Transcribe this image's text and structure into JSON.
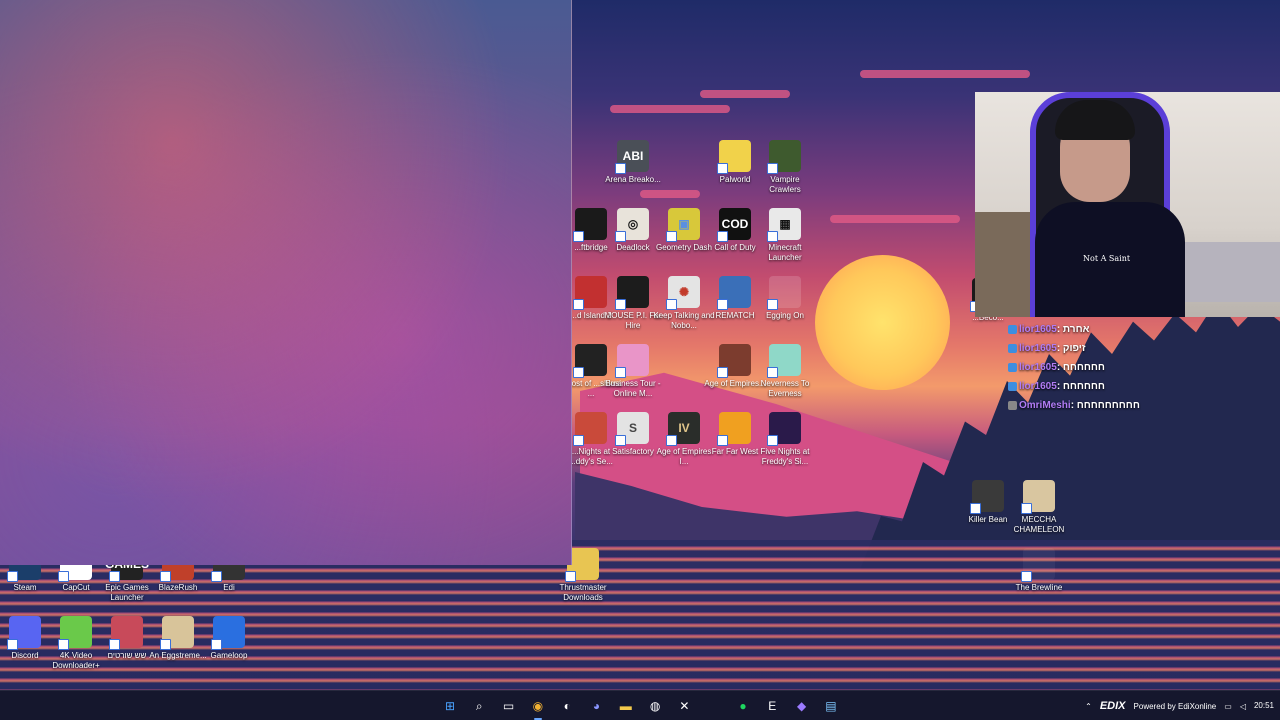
{
  "desktop": {
    "icons": [
      {
        "label": "Arena Breako...",
        "glyph": "ABI",
        "bg": "#4a4f57",
        "fg": "#ffffff"
      },
      {
        "label": "Palworld",
        "glyph": "",
        "bg": "#f1d24a",
        "fg": "#2b6bb5"
      },
      {
        "label": "Vampire Crawlers",
        "glyph": "",
        "bg": "#3e5a2e",
        "fg": "#ffffff"
      },
      {
        "label": "Deadlock",
        "glyph": "◎",
        "bg": "#e8e3da",
        "fg": "#1a1a1a"
      },
      {
        "label": "Geometry Dash",
        "glyph": "▣",
        "bg": "#d8c83a",
        "fg": "#5a8fe0"
      },
      {
        "label": "Call of Duty",
        "glyph": "COD",
        "bg": "#111111",
        "fg": "#ffffff"
      },
      {
        "label": "Minecraft Launcher",
        "glyph": "▦",
        "bg": "#e9e9e9",
        "fg": "#111111"
      },
      {
        "label": "MOUSE P.I. For Hire",
        "glyph": "",
        "bg": "#1c1c1c",
        "fg": "#ffffff"
      },
      {
        "label": "Keep Talking and Nobo...",
        "glyph": "✺",
        "bg": "#e4e4e4",
        "fg": "#c23a2a"
      },
      {
        "label": "REMATCH",
        "glyph": "",
        "bg": "#3a6fb8",
        "fg": "#ffffff"
      },
      {
        "label": "Egging On",
        "glyph": "",
        "bg": "rgba(255,255,255,0.15)",
        "fg": "#ffffff"
      },
      {
        "label": "Business Tour - Online M...",
        "glyph": "",
        "bg": "#e995c8",
        "fg": "#ffffff"
      },
      {
        "label": "Age of Empires...",
        "glyph": "",
        "bg": "#7c3c2e",
        "fg": "#ffffff"
      },
      {
        "label": "Neverness To Everness",
        "glyph": "",
        "bg": "#8fd8c8",
        "fg": "#ffffff"
      },
      {
        "label": "Satisfactory",
        "glyph": "S",
        "bg": "#e3e3e3",
        "fg": "#444444"
      },
      {
        "label": "Age of Empires I...",
        "glyph": "IV",
        "bg": "#2a2d2a",
        "fg": "#e0c58a"
      },
      {
        "label": "Far Far West",
        "glyph": "",
        "bg": "#f0a020",
        "fg": "#1a1a1a"
      },
      {
        "label": "Five Nights at Freddy's Si...",
        "glyph": "",
        "bg": "#2a1a4a",
        "fg": "#ffffff"
      },
      {
        "label": "Killer Bean",
        "glyph": "",
        "bg": "#3a3a3a",
        "fg": "#ffffff"
      },
      {
        "label": "MECCHA CHAMELEON",
        "glyph": "",
        "bg": "#d9c6a0",
        "fg": "#ffffff"
      },
      {
        "label": "The Brewline",
        "glyph": "",
        "bg": "rgba(255,255,255,0.05)",
        "fg": "#ffffff"
      },
      {
        "label": "Thrustmaster Downloads",
        "glyph": "",
        "bg": "#e8c552",
        "fg": "#ffffff"
      },
      {
        "label": "Steam",
        "glyph": "",
        "bg": "#1b3e6a",
        "fg": "#ffffff"
      },
      {
        "label": "CapCut",
        "glyph": "",
        "bg": "#ffffff",
        "fg": "#111111"
      },
      {
        "label": "Epic Games Launcher",
        "glyph": "GAMES",
        "bg": "#222222",
        "fg": "#ffffff"
      },
      {
        "label": "BlazeRush",
        "glyph": "",
        "bg": "#c0402a",
        "fg": "#ffffff"
      },
      {
        "label": "Edi",
        "glyph": "",
        "bg": "#333333",
        "fg": "#ffffff"
      },
      {
        "label": "Discord",
        "glyph": "",
        "bg": "#5865f2",
        "fg": "#ffffff"
      },
      {
        "label": "4K Video Downloader+",
        "glyph": "",
        "bg": "#6ac94a",
        "fg": "#ffffff"
      },
      {
        "label": "שש שורטים",
        "glyph": "",
        "bg": "#c84a5a",
        "fg": "#ffffff"
      },
      {
        "label": "An Eggstreme...",
        "glyph": "",
        "bg": "#d8c49a",
        "fg": "#ffffff"
      },
      {
        "label": "Gameloop",
        "glyph": "",
        "bg": "#2a6fe0",
        "fg": "#ffffff"
      }
    ],
    "partial_labels": [
      {
        "text": "...ftbridge"
      },
      {
        "text": "...d Island 2"
      },
      {
        "text": "...host of ...shima ..."
      },
      {
        "text": "...Nights at ...ddy's Se..."
      },
      {
        "text": "...Beco..."
      }
    ]
  },
  "chat": {
    "lines": [
      {
        "user": "lior1605",
        "msg": ": אחרת"
      },
      {
        "user": "lior1605",
        "msg": ": זיפוק"
      },
      {
        "user": "lior1605",
        "msg": ": חחחחחח"
      },
      {
        "user": "lior1605",
        "msg": ": חחחחחח"
      },
      {
        "user": "OmriMeshi",
        "msg": ": חחחחחחחחח"
      }
    ]
  },
  "webcam": {
    "shirt_text": "Not A Saint"
  },
  "taskbar": {
    "apps": [
      {
        "name": "start",
        "glyph": "⊞",
        "color": "#4aa3ff"
      },
      {
        "name": "search",
        "glyph": "⌕",
        "color": "#ffffff"
      },
      {
        "name": "task-view",
        "glyph": "▭",
        "color": "#ffffff"
      },
      {
        "name": "chrome",
        "glyph": "◉",
        "color": "#f2b233"
      },
      {
        "name": "steam",
        "glyph": "◐",
        "color": "#ffffff"
      },
      {
        "name": "discord",
        "glyph": "◕",
        "color": "#8a96ff"
      },
      {
        "name": "file-explorer",
        "glyph": "▬",
        "color": "#f2c94c"
      },
      {
        "name": "obs",
        "glyph": "◍",
        "color": "#ffffff"
      },
      {
        "name": "capcut",
        "glyph": "✕",
        "color": "#ffffff"
      },
      {
        "name": "blank",
        "glyph": "",
        "color": "#ffffff"
      },
      {
        "name": "spotify",
        "glyph": "●",
        "color": "#1ed760"
      },
      {
        "name": "epic-games",
        "glyph": "E",
        "color": "#ffffff"
      },
      {
        "name": "visual-studio",
        "glyph": "◆",
        "color": "#9b7bff"
      },
      {
        "name": "notepad",
        "glyph": "▤",
        "color": "#7ec8ff"
      }
    ],
    "tray": {
      "brand": "EDIX",
      "powered": "Powered by EdiXonline",
      "time": "20:51"
    }
  }
}
